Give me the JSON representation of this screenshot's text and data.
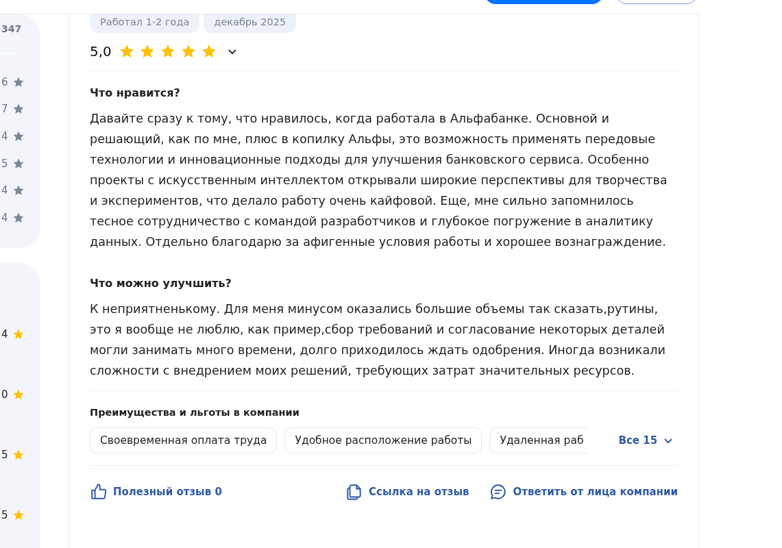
{
  "sidebar": {
    "total": "347",
    "distribution": [
      {
        "count": "6"
      },
      {
        "count": "7"
      },
      {
        "count": "4"
      },
      {
        "count": "5"
      },
      {
        "count": "4"
      },
      {
        "count": "4"
      }
    ],
    "category_ratings": [
      {
        "value": "4"
      },
      {
        "value": "0"
      },
      {
        "value": "5"
      },
      {
        "value": "5"
      }
    ]
  },
  "review": {
    "tags": [
      "Работал 1-2 года",
      "декабрь 2025"
    ],
    "rating": {
      "value": "5,0",
      "stars": 5
    },
    "sections": [
      {
        "heading": "Что нравится?",
        "text": "Давайте сразу к тому, что нравилось, когда работала в Альфабанке. Основной и решающий, как по мне, плюс в копилку Альфы, это возможность применять передовые технологии и инновационные подходы для улучшения банковского сервиса. Особенно проекты с искусственным интеллектом открывали широкие перспективы для творчества и экспериментов, что делало работу очень кайфовой. Еще, мне сильно запомнилось тесное сотрудничество с командой разработчиков и глубокое погружение в аналитику данных. Отдельно благодарю за афигенные условия работы и хорошее вознаграждение."
      },
      {
        "heading": "Что можно улучшить?",
        "text": "К неприятненькому. Для меня минусом оказались большие объемы так сказать,рутины, это я вообще не люблю, как пример,сбор требований и согласование некоторых деталей могли занимать много времени, долго приходилось ждать одобрения. Иногда возникали сложности с внедрением моих решений, требующих затрат значительных ресурсов."
      }
    ],
    "benefits": {
      "heading": "Преимущества и льготы в компании",
      "items": [
        "Своевременная оплата труда",
        "Удобное расположение работы",
        "Удаленная раб"
      ],
      "more": "Все 15"
    },
    "actions": [
      {
        "kind": "like",
        "label": "Полезный отзыв 0"
      },
      {
        "kind": "link",
        "label": "Ссылка на отзыв"
      },
      {
        "kind": "reply",
        "label": "Ответить от лица компании"
      }
    ]
  }
}
